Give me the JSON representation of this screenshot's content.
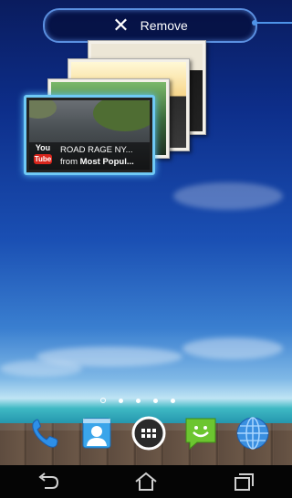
{
  "remove_bar": {
    "label": "Remove"
  },
  "recent_card": {
    "title": "ROAD RAGE NY...",
    "subtitle_prefix": "from ",
    "subtitle_bold": "Most Popul...",
    "logo_you": "You",
    "logo_tube": "Tube"
  },
  "home_pages": {
    "count": 5,
    "active_index": 0
  },
  "dock": {
    "apps": [
      {
        "name": "phone",
        "icon": "phone-icon"
      },
      {
        "name": "contacts",
        "icon": "contacts-icon"
      },
      {
        "name": "all-apps",
        "icon": "app-drawer-icon"
      },
      {
        "name": "messaging",
        "icon": "messaging-icon"
      },
      {
        "name": "browser",
        "icon": "globe-icon"
      }
    ]
  },
  "nav": {
    "buttons": [
      {
        "name": "back",
        "icon": "back-icon"
      },
      {
        "name": "home",
        "icon": "home-icon"
      },
      {
        "name": "recent-apps",
        "icon": "recent-apps-icon"
      }
    ]
  },
  "colors": {
    "accent": "#5a8fe0",
    "card_highlight": "#6fc9f5",
    "youtube_red": "#d8251c",
    "navbar": "#050505"
  }
}
